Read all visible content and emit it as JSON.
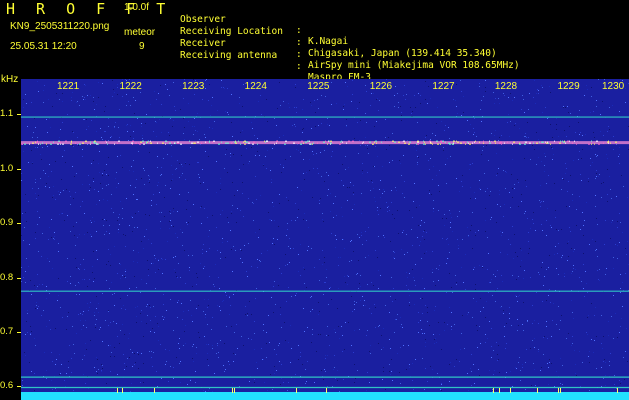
{
  "header": {
    "app_title": "H R O F F T",
    "app_version": "1.0.0f",
    "file_name": "KN9_2505311220.png",
    "timestamp": "25.05.31 12:20",
    "meteor_label": "meteor",
    "meteor_count": "9",
    "info": [
      {
        "key": "Observer",
        "sep": ":",
        "value": "K.Nagai"
      },
      {
        "key": "Receiving Location",
        "sep": ":",
        "value": "Chigasaki, Japan (139.414 35.340)"
      },
      {
        "key": "Receiver",
        "sep": ":",
        "value": "AirSpy mini (Miakejima VOR 108.65MHz)"
      },
      {
        "key": "Receiving antenna",
        "sep": ":",
        "value": "Maspro FM-3"
      }
    ]
  },
  "colors": {
    "text": "#ffff33",
    "background_noise": "#1a1fa0",
    "carrier_line": "#33d6c8",
    "baseline": "#22e0ff"
  },
  "chart_data": {
    "type": "heatmap",
    "y_unit": "kHz",
    "y_ticks": [
      "1.1",
      "1.0",
      "0.9",
      "0.8",
      "0.7",
      "0.6"
    ],
    "y_tick_values": [
      1.1,
      1.0,
      0.9,
      0.8,
      0.7,
      0.6
    ],
    "ylim": [
      0.575,
      1.165
    ],
    "x_ticks": [
      "1221",
      "1222",
      "1223",
      "1224",
      "1225",
      "1226",
      "1227",
      "1228",
      "1229",
      "1230"
    ],
    "horizontal_lines_khz": [
      1.095,
      1.048,
      0.775,
      0.617,
      0.598
    ],
    "grid": false
  }
}
